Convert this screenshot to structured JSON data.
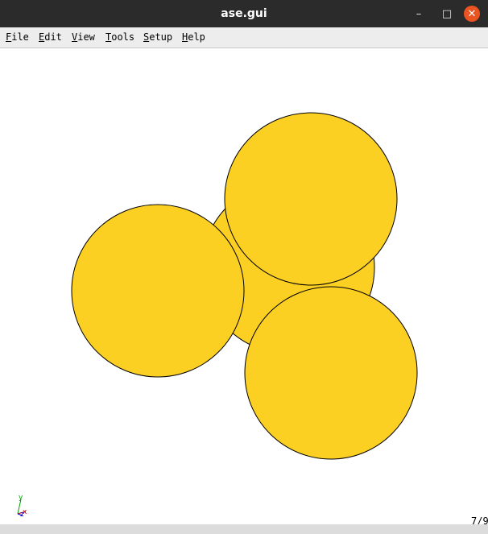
{
  "window": {
    "title": "ase.gui",
    "controls": {
      "minimize": "–",
      "maximize": "□",
      "close": "✕"
    }
  },
  "menu": {
    "items": [
      {
        "label_acc": "F",
        "label_rest": "ile"
      },
      {
        "label_acc": "E",
        "label_rest": "dit"
      },
      {
        "label_acc": "V",
        "label_rest": "iew"
      },
      {
        "label_acc": "T",
        "label_rest": "ools"
      },
      {
        "label_acc": "S",
        "label_rest": "etup"
      },
      {
        "label_acc": "H",
        "label_rest": "elp"
      }
    ]
  },
  "viewer": {
    "atom_color": "#fcd022",
    "atom_outline": "#000000",
    "axes": {
      "y_label": "y",
      "x_label": "x",
      "z_label": "z",
      "y_color": "#00a000",
      "x_color": "#d00000",
      "z_color": "#0000d0"
    },
    "frame_counter": "7/9"
  }
}
